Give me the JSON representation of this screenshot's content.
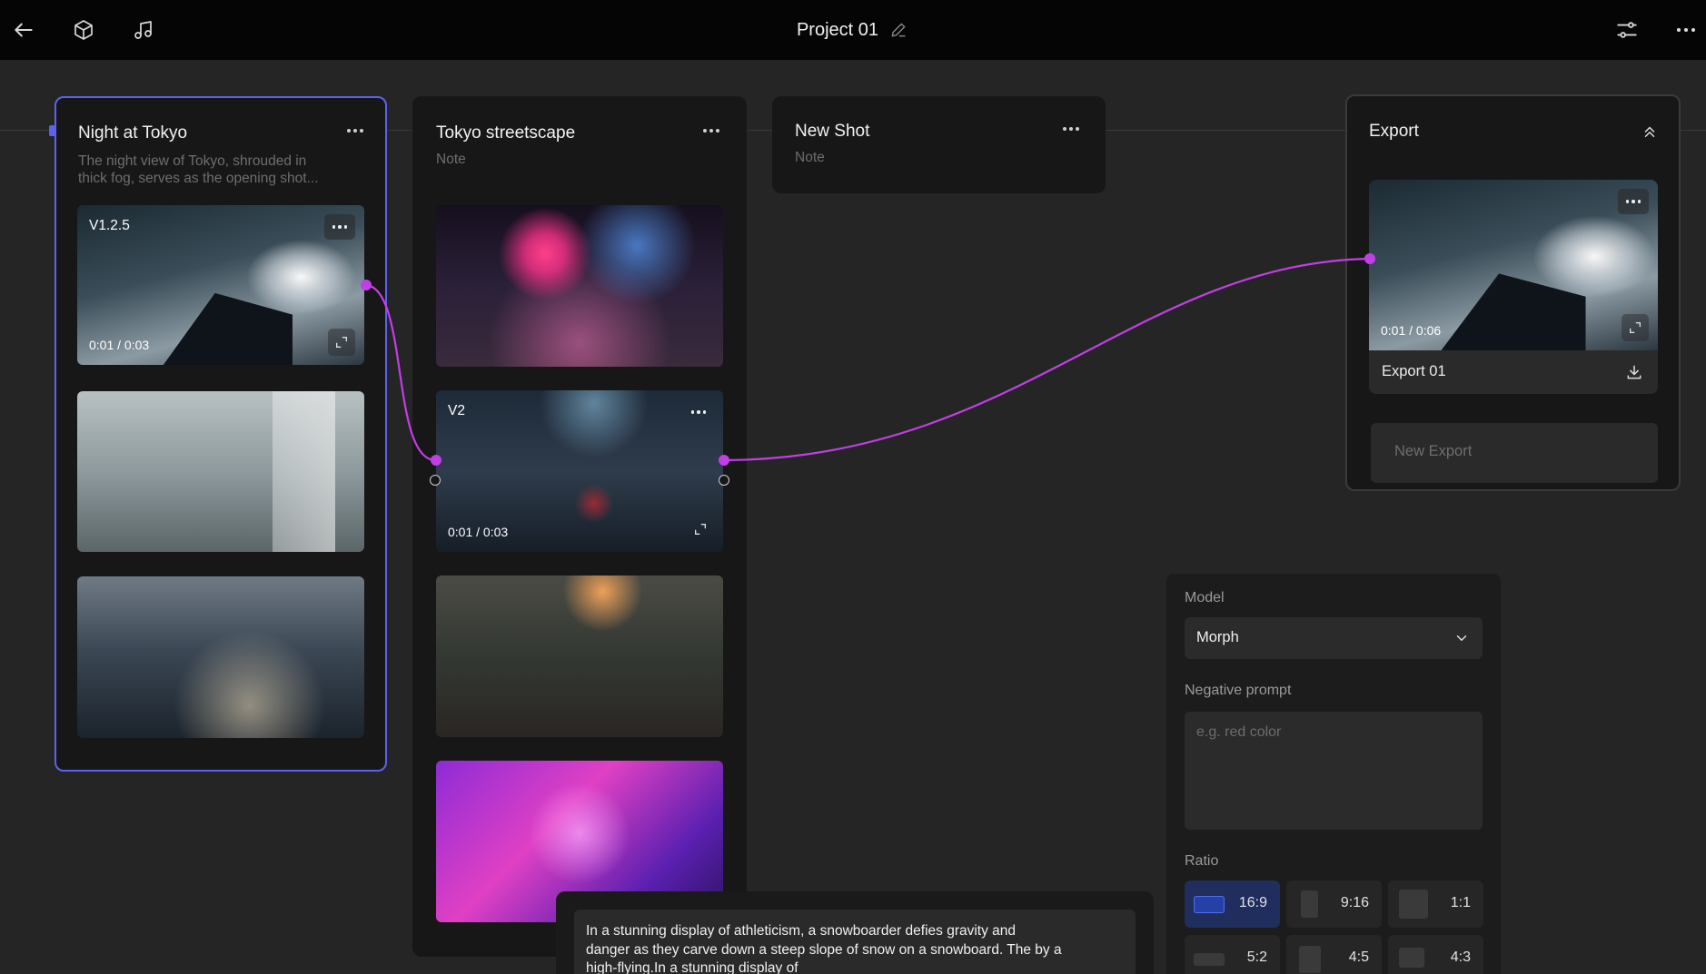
{
  "header": {
    "title": "Project 01"
  },
  "cards": [
    {
      "title": "Night at Tokyo",
      "note_line1": "The night view of Tokyo, shrouded in",
      "note_line2": "thick fog, serves as the opening shot...",
      "shots": [
        {
          "tag": "V1.2.5",
          "time": "0:01 / 0:03"
        },
        {},
        {}
      ]
    },
    {
      "title": "Tokyo streetscape",
      "note": "Note",
      "shots": [
        {},
        {
          "tag": "V2",
          "time": "0:01 / 0:03"
        },
        {},
        {}
      ]
    },
    {
      "title": "New Shot",
      "note": "Note"
    }
  ],
  "export": {
    "title": "Export",
    "time": "0:01 / 0:06",
    "item_label": "Export 01",
    "new_export_label": "New Export"
  },
  "settings": {
    "model_label": "Model",
    "model_value": "Morph",
    "negative_label": "Negative prompt",
    "negative_placeholder": "e.g. red color",
    "ratio_label": "Ratio",
    "ratios": [
      "16:9",
      "9:16",
      "1:1",
      "5:2",
      "4:5",
      "4:3"
    ],
    "selected_ratio": "16:9"
  },
  "prompt": {
    "line1": "In a stunning display of athleticism, a snowboarder defies gravity and",
    "line2": "danger as they carve down a steep slope of snow on a snowboard. The by a",
    "line3": "high-flying.In a stunning display of"
  },
  "colors": {
    "accent_connection": "#c23ee6",
    "selection_border": "#5b62f0",
    "background": "#252525"
  },
  "icons": [
    "back-arrow-icon",
    "cube-icon",
    "music-note-icon",
    "edit-pencil-icon",
    "sliders-icon",
    "more-horizontal-icon",
    "collapse-icon",
    "download-icon",
    "chevron-down-icon",
    "expand-icon"
  ]
}
